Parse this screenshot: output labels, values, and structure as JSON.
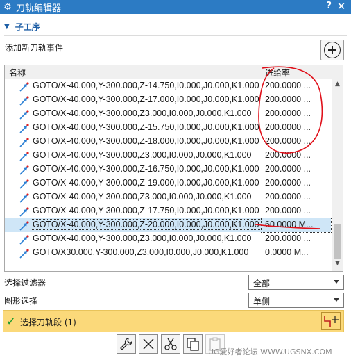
{
  "window": {
    "title": "刀轨编辑器",
    "help": "?",
    "close": "✕"
  },
  "section": {
    "title": "子工序"
  },
  "add_event": {
    "label": "添加新刀轨事件"
  },
  "table": {
    "columns": [
      "名称",
      "进给率"
    ],
    "rows": [
      {
        "code": "GOTO/X-40.000,Y-300.000,Z-14.750,I0.000,J0.000,K1.000",
        "feed": "200.0000 ..."
      },
      {
        "code": "GOTO/X-40.000,Y-300.000,Z-17.000,I0.000,J0.000,K1.000",
        "feed": "200.0000 ..."
      },
      {
        "code": "GOTO/X-40.000,Y-300.000,Z3.000,I0.000,J0.000,K1.000",
        "feed": "200.0000 ..."
      },
      {
        "code": "GOTO/X-40.000,Y-300.000,Z-15.750,I0.000,J0.000,K1.000",
        "feed": "200.0000 ..."
      },
      {
        "code": "GOTO/X-40.000,Y-300.000,Z-18.000,I0.000,J0.000,K1.000",
        "feed": "200.0000 ..."
      },
      {
        "code": "GOTO/X-40.000,Y-300.000,Z3.000,I0.000,J0.000,K1.000",
        "feed": "200.0000 ..."
      },
      {
        "code": "GOTO/X-40.000,Y-300.000,Z-16.750,I0.000,J0.000,K1.000",
        "feed": "200.0000 ..."
      },
      {
        "code": "GOTO/X-40.000,Y-300.000,Z-19.000,I0.000,J0.000,K1.000",
        "feed": "200.0000 ..."
      },
      {
        "code": "GOTO/X-40.000,Y-300.000,Z3.000,I0.000,J0.000,K1.000",
        "feed": "200.0000 ..."
      },
      {
        "code": "GOTO/X-40.000,Y-300.000,Z-17.750,I0.000,J0.000,K1.000",
        "feed": "200.0000 ..."
      },
      {
        "code": "GOTO/X-40.000,Y-300.000,Z-20.000,I0.000,J0.000,K1.000",
        "feed": "60.0000 M..."
      },
      {
        "code": "GOTO/X-40.000,Y-300.000,Z3.000,I0.000,J0.000,K1.000",
        "feed": "200.0000 ..."
      },
      {
        "code": "GOTO/X30.000,Y-300.000,Z3.000,I0.000,J0.000,K1.000",
        "feed": "0.0000 M..."
      }
    ],
    "selected_row": 10
  },
  "filter": {
    "label": "选择过滤器",
    "value": "全部"
  },
  "shape": {
    "label": "图形选择",
    "value": "单侧"
  },
  "select_segment": {
    "label": "选择刀轨段 (1)"
  },
  "watermark": "UG爱好者论坛 WWW.UGSNX.COM",
  "colors": {
    "titlebar": "#2c7bc4",
    "accent": "#1f5fa6",
    "selection_bar": "#fbd97a",
    "selected_row": "#cfe6f7",
    "annotation_red": "#e0101a"
  },
  "icons": {
    "title": "gear-icon",
    "add": "circle-plus-icon",
    "row": "toolpath-arrow-icon",
    "toolbar": [
      "wrench-icon",
      "delete-x-icon",
      "cut-scissors-icon",
      "copy-icon",
      "paste-icon"
    ],
    "select_tool": "crosshair-path-icon"
  }
}
